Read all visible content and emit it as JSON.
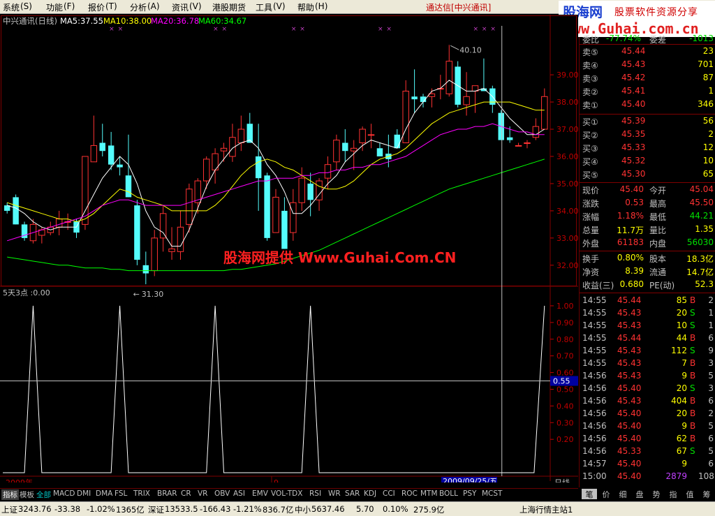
{
  "menu": [
    "系统",
    "功能",
    "报价",
    "分析",
    "资讯",
    "港股期货",
    "工具",
    "帮助"
  ],
  "menu_keys": [
    "(S)",
    "(F)",
    "(T)",
    "(A)",
    "(V)",
    "",
    "(V)",
    "(H)"
  ],
  "app_title": "通达信[中兴通讯]",
  "logo": {
    "main": "股海网",
    "tag": "股票软件资源分享",
    "url": "www.Guhai.com.cn"
  },
  "watermark": "股海网提供 Www.Guhai.Com.CN",
  "colors": {
    "up": "#ff3232",
    "down": "#54fcfc",
    "ma5": "#ffffff",
    "ma10": "#ffff00",
    "ma20": "#ff00ff",
    "ma60": "#00ff00"
  },
  "chart_header": {
    "name": "中兴通讯(日线)",
    "ma5": "MA5:37.55",
    "ma10": "MA10:38.00",
    "ma20": "MA20:36.78",
    "ma60": "MA60:34.67"
  },
  "indicator_header": "5天3点 :0.00",
  "date_axis": {
    "left": "2009年",
    "mid": "9",
    "cursor": "2009/09/25/五",
    "right": "日线"
  },
  "cursor_value": "0.55",
  "chart_data": [
    {
      "type": "candlestick",
      "ylim": [
        31.2,
        40.8
      ],
      "yticks": [
        "39.00",
        "38.00",
        "37.00",
        "36.00",
        "35.00",
        "34.00",
        "33.00",
        "32.00"
      ],
      "max_label": "40.10",
      "min_label": "31.30",
      "candles": [
        [
          34.2,
          34.3,
          33.9,
          34.0
        ],
        [
          34.5,
          34.6,
          33.5,
          33.5
        ],
        [
          33.5,
          33.6,
          32.9,
          33.0
        ],
        [
          32.9,
          33.7,
          32.8,
          33.5
        ],
        [
          33.1,
          33.4,
          32.8,
          33.3
        ],
        [
          33.2,
          33.6,
          33.1,
          33.4
        ],
        [
          33.4,
          34.0,
          33.1,
          33.7
        ],
        [
          33.6,
          33.9,
          33.3,
          33.6
        ],
        [
          33.6,
          33.7,
          33.0,
          33.2
        ],
        [
          33.5,
          36.0,
          33.3,
          36.0
        ],
        [
          35.8,
          37.5,
          35.8,
          36.4
        ],
        [
          36.5,
          37.2,
          36.0,
          36.2
        ],
        [
          36.4,
          36.9,
          35.5,
          35.7
        ],
        [
          35.7,
          36.0,
          35.3,
          35.6
        ],
        [
          35.3,
          36.8,
          34.5,
          34.5
        ],
        [
          34.2,
          34.4,
          32.0,
          32.2
        ],
        [
          32.0,
          32.5,
          31.3,
          31.7
        ],
        [
          31.8,
          33.3,
          31.6,
          33.0
        ],
        [
          33.0,
          34.2,
          32.5,
          33.9
        ],
        [
          32.5,
          33.4,
          32.2,
          32.6
        ],
        [
          32.5,
          34.0,
          32.2,
          33.4
        ],
        [
          33.5,
          35.0,
          33.2,
          34.8
        ],
        [
          34.3,
          35.2,
          33.9,
          35.1
        ],
        [
          35.1,
          36.0,
          34.8,
          35.9
        ],
        [
          35.5,
          36.3,
          35.0,
          36.1
        ],
        [
          36.2,
          36.5,
          35.8,
          36.3
        ],
        [
          36.0,
          37.2,
          35.8,
          36.7
        ],
        [
          36.5,
          37.5,
          36.2,
          37.0
        ],
        [
          37.2,
          37.6,
          36.5,
          36.5
        ],
        [
          36.0,
          37.2,
          34.0,
          35.2
        ],
        [
          35.3,
          35.4,
          32.9,
          33.0
        ],
        [
          33.2,
          34.8,
          33.2,
          34.5
        ],
        [
          34.0,
          34.5,
          32.6,
          32.6
        ],
        [
          33.2,
          34.8,
          32.9,
          34.3
        ],
        [
          34.3,
          35.6,
          34.0,
          35.2
        ],
        [
          35.0,
          35.4,
          33.8,
          34.4
        ],
        [
          34.4,
          35.2,
          34.0,
          35.1
        ],
        [
          35.2,
          36.0,
          34.8,
          35.7
        ],
        [
          35.8,
          36.8,
          35.5,
          36.6
        ],
        [
          36.5,
          37.0,
          35.8,
          36.2
        ],
        [
          36.2,
          36.6,
          35.5,
          36.3
        ],
        [
          36.5,
          37.1,
          36.2,
          37.0
        ],
        [
          36.8,
          37.2,
          36.3,
          36.8
        ],
        [
          36.3,
          36.5,
          36.0,
          36.0
        ],
        [
          36.1,
          36.8,
          35.6,
          35.9
        ],
        [
          36.8,
          37.0,
          36.3,
          36.3
        ],
        [
          36.5,
          38.8,
          36.5,
          38.4
        ],
        [
          38.2,
          39.2,
          37.6,
          38.1
        ],
        [
          38.2,
          38.3,
          37.8,
          38.0
        ],
        [
          38.2,
          38.5,
          37.8,
          38.3
        ],
        [
          38.5,
          39.0,
          38.1,
          38.5
        ],
        [
          38.3,
          40.1,
          38.2,
          39.5
        ],
        [
          39.3,
          39.5,
          37.8,
          37.9
        ],
        [
          37.9,
          39.1,
          37.5,
          38.2
        ],
        [
          38.4,
          38.6,
          37.6,
          38.6
        ],
        [
          38.5,
          39.6,
          38.4,
          38.4
        ],
        [
          38.5,
          38.6,
          37.6,
          37.9
        ],
        [
          37.6,
          37.7,
          36.6,
          36.6
        ],
        [
          36.7,
          37.1,
          36.5,
          36.6
        ],
        [
          36.4,
          36.5,
          36.4,
          36.4
        ],
        [
          36.5,
          36.6,
          36.3,
          36.5
        ],
        [
          36.7,
          37.4,
          36.6,
          37.1
        ],
        [
          37.0,
          38.5,
          37.0,
          38.2
        ]
      ],
      "ma5": [
        34.2,
        34.1,
        33.9,
        33.6,
        33.4,
        33.3,
        33.4,
        33.4,
        33.4,
        34.0,
        34.6,
        35.2,
        35.6,
        36.0,
        35.7,
        35.0,
        34.0,
        33.4,
        33.2,
        32.7,
        32.7,
        33.3,
        34.1,
        34.9,
        35.5,
        35.9,
        36.3,
        36.5,
        36.6,
        36.3,
        35.7,
        35.3,
        34.7,
        33.9,
        33.9,
        34.2,
        34.6,
        35.0,
        35.3,
        35.8,
        36.1,
        36.4,
        36.6,
        36.5,
        36.4,
        36.3,
        37.0,
        37.6,
        38.0,
        38.4,
        38.5,
        38.8,
        38.6,
        38.4,
        38.4,
        38.5,
        38.2,
        37.8,
        37.4,
        37.1,
        36.8,
        36.8,
        37.0
      ],
      "ma10": [
        34.3,
        34.2,
        34.1,
        34.0,
        33.9,
        33.8,
        33.7,
        33.7,
        33.6,
        33.7,
        33.9,
        34.2,
        34.5,
        34.8,
        34.7,
        34.5,
        34.4,
        34.3,
        34.2,
        34.0,
        34.0,
        34.0,
        34.0,
        34.0,
        34.2,
        34.5,
        34.9,
        35.3,
        35.6,
        35.8,
        35.9,
        35.8,
        35.6,
        35.5,
        35.3,
        35.1,
        34.9,
        34.8,
        34.8,
        34.9,
        35.1,
        35.4,
        35.7,
        35.9,
        36.0,
        36.1,
        36.3,
        36.6,
        36.9,
        37.2,
        37.4,
        37.6,
        37.7,
        37.8,
        37.9,
        38.0,
        38.0,
        38.0,
        38.0,
        37.9,
        37.8,
        37.7,
        37.7
      ],
      "ma20": [
        32.9,
        33.0,
        33.1,
        33.2,
        33.3,
        33.4,
        33.5,
        33.6,
        33.7,
        33.8,
        34.0,
        34.2,
        34.3,
        34.4,
        34.4,
        34.3,
        34.2,
        34.2,
        34.2,
        34.2,
        34.2,
        34.3,
        34.4,
        34.5,
        34.6,
        34.7,
        34.8,
        34.9,
        35.0,
        35.1,
        35.1,
        35.2,
        35.2,
        35.2,
        35.3,
        35.3,
        35.4,
        35.4,
        35.5,
        35.5,
        35.6,
        35.6,
        35.7,
        35.7,
        35.8,
        35.9,
        36.0,
        36.2,
        36.4,
        36.6,
        36.8,
        36.9,
        37.0,
        37.0,
        37.1,
        37.1,
        37.2,
        37.1,
        37.0,
        36.9,
        36.9,
        36.8,
        36.8
      ],
      "ma60": [
        32.3,
        32.25,
        32.2,
        32.15,
        32.1,
        32.05,
        32.0,
        32.0,
        31.95,
        31.9,
        31.9,
        31.9,
        31.85,
        31.85,
        31.8,
        31.8,
        31.8,
        31.8,
        31.8,
        31.8,
        31.8,
        31.8,
        31.8,
        31.8,
        31.8,
        31.8,
        31.85,
        31.85,
        31.9,
        31.95,
        32.0,
        32.05,
        32.15,
        32.25,
        32.35,
        32.45,
        32.55,
        32.7,
        32.85,
        33.0,
        33.15,
        33.3,
        33.45,
        33.6,
        33.75,
        33.9,
        34.05,
        34.2,
        34.35,
        34.5,
        34.65,
        34.8,
        34.9,
        35.0,
        35.1,
        35.2,
        35.3,
        35.4,
        35.5,
        35.6,
        35.7,
        35.8,
        35.9
      ]
    },
    {
      "type": "line",
      "name": "5天3点",
      "ylim": [
        0,
        1.05
      ],
      "yticks": [
        "1.00",
        "0.90",
        "0.80",
        "0.70",
        "0.60",
        "0.50",
        "0.40",
        "0.30",
        "0.20"
      ],
      "peaks_x": [
        3,
        13,
        24,
        35,
        62
      ],
      "values_desc": "0 baseline with spikes to 1.00"
    }
  ],
  "tabs": [
    "指标",
    "模板",
    "全部",
    "MACD",
    "DMI",
    "DMA",
    "FSL",
    "TRIX",
    "BRAR",
    "CR",
    "VR",
    "OBV",
    "ASI",
    "EMV",
    "VOL-TDX",
    "RSI",
    "WR",
    "SAR",
    "KDJ",
    "CCI",
    "ROC",
    "MTM",
    "BOLL",
    "PSY",
    "MCST"
  ],
  "quote": {
    "wb_label": "委比",
    "wb_val": "-77.74%",
    "wc_label": "委差",
    "wc_val": "-1013",
    "sells": [
      {
        "label": "卖⑤",
        "price": "45.44",
        "vol": "23"
      },
      {
        "label": "卖④",
        "price": "45.43",
        "vol": "701"
      },
      {
        "label": "卖③",
        "price": "45.42",
        "vol": "87"
      },
      {
        "label": "卖②",
        "price": "45.41",
        "vol": "1"
      },
      {
        "label": "卖①",
        "price": "45.40",
        "vol": "346"
      }
    ],
    "buys": [
      {
        "label": "买①",
        "price": "45.39",
        "vol": "56"
      },
      {
        "label": "买②",
        "price": "45.35",
        "vol": "2"
      },
      {
        "label": "买③",
        "price": "45.33",
        "vol": "12"
      },
      {
        "label": "买④",
        "price": "45.32",
        "vol": "10"
      },
      {
        "label": "买⑤",
        "price": "45.30",
        "vol": "65"
      }
    ],
    "stats": [
      [
        "现价",
        "45.40",
        "今开",
        "45.04"
      ],
      [
        "涨跌",
        "0.53",
        "最高",
        "45.50"
      ],
      [
        "涨幅",
        "1.18%",
        "最低",
        "44.21"
      ],
      [
        "总量",
        "11.7万",
        "量比",
        "1.35"
      ],
      [
        "外盘",
        "61183",
        "内盘",
        "56030"
      ]
    ],
    "stats2": [
      [
        "换手",
        "0.80%",
        "股本",
        "18.3亿"
      ],
      [
        "净资",
        "8.39",
        "流通",
        "14.7亿"
      ],
      [
        "收益(三)",
        "0.680",
        "PE(动)",
        "52.3"
      ]
    ],
    "ticks": [
      [
        "14:55",
        "45.44",
        "85",
        "B",
        "2"
      ],
      [
        "14:55",
        "45.43",
        "20",
        "S",
        "1"
      ],
      [
        "14:55",
        "45.43",
        "10",
        "S",
        "1"
      ],
      [
        "14:55",
        "45.44",
        "44",
        "B",
        "6"
      ],
      [
        "14:55",
        "45.43",
        "112",
        "S",
        "9"
      ],
      [
        "14:55",
        "45.43",
        "7",
        "B",
        "3"
      ],
      [
        "14:56",
        "45.43",
        "9",
        "B",
        "5"
      ],
      [
        "14:56",
        "45.40",
        "20",
        "S",
        "3"
      ],
      [
        "14:56",
        "45.43",
        "404",
        "B",
        "6"
      ],
      [
        "14:56",
        "45.40",
        "20",
        "B",
        "2"
      ],
      [
        "14:56",
        "45.40",
        "9",
        "B",
        "5"
      ],
      [
        "14:56",
        "45.40",
        "62",
        "B",
        "6"
      ],
      [
        "14:56",
        "45.33",
        "67",
        "S",
        "5"
      ],
      [
        "14:57",
        "45.40",
        "9",
        "",
        "6"
      ],
      [
        "15:00",
        "45.40",
        "2879",
        "",
        "108"
      ]
    ]
  },
  "side_tabs": [
    "笔",
    "价",
    "细",
    "盘",
    "势",
    "指",
    "值",
    "筹"
  ],
  "status": {
    "sh_label": "上证",
    "sh_val": "3243.76",
    "sh_chg": "-33.38",
    "sh_pct": "-1.02%",
    "sh_amt": "1365亿",
    "sz_label": "深证",
    "sz_val": "13533.5",
    "sz_chg": "-166.43",
    "sz_pct": "-1.21%",
    "sz_amt": "836.7亿",
    "zx_label": "中小",
    "zx_val": "5637.46",
    "zx_chg": "5.70",
    "zx_pct": "0.10%",
    "zx_amt": "275.9亿",
    "server": "上海行情主站1"
  }
}
